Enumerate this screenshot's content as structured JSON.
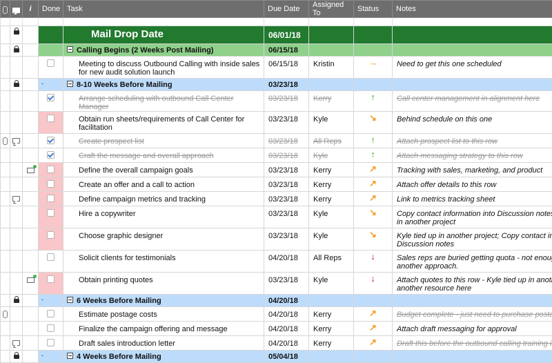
{
  "header": {
    "columns": [
      "",
      "",
      "i",
      "Done",
      "Task",
      "Due Date",
      "Assigned To",
      "Status",
      "Notes"
    ]
  },
  "rows": [
    {
      "kind": "sheet",
      "locked": true,
      "task": "Mail Drop Date",
      "due": "06/01/18"
    },
    {
      "kind": "section",
      "color": "green",
      "locked": true,
      "task": "Calling Begins (2 Weeks Post Mailing)",
      "due": "06/15/18"
    },
    {
      "kind": "task",
      "lines": 2,
      "done": false,
      "doneRed": false,
      "task": "Meeting to discuss Outbound Calling with inside sales for new audit solution launch",
      "due": "06/15/18",
      "assigned": "Kristin",
      "status": "right",
      "notes": "Need to get this one scheduled"
    },
    {
      "kind": "section",
      "color": "blue",
      "locked": true,
      "task": "8-10 Weeks Before Mailing",
      "due": "03/23/18"
    },
    {
      "kind": "task",
      "lines": 1,
      "done": true,
      "doneRed": false,
      "strike": true,
      "task": "Arrange scheduling with outbound Call Center Manager",
      "due": "03/23/18",
      "assigned": "Kerry",
      "status": "up",
      "notes": "Call center management in alignment here",
      "notesStrike": true
    },
    {
      "kind": "task",
      "lines": 2,
      "done": false,
      "doneRed": true,
      "task": "Obtain run sheets/requirements of Call Center for facilitation",
      "due": "03/23/18",
      "assigned": "Kyle",
      "status": "downright",
      "notes": "Behind schedule on this one"
    },
    {
      "kind": "task",
      "lines": 1,
      "done": true,
      "doneRed": false,
      "strike": true,
      "attach": true,
      "comment": true,
      "task": "Create prospect list",
      "due": "03/23/18",
      "assigned": "All Reps",
      "status": "up",
      "notes": "Attach prospect list to this row",
      "notesStrike": true
    },
    {
      "kind": "task",
      "lines": 1,
      "done": true,
      "doneRed": false,
      "strike": true,
      "task": "Craft the message and overall approach",
      "due": "03/23/18",
      "assigned": "Kyle",
      "status": "up",
      "notes": "Attach messaging strategy to this row",
      "notesStrike": true
    },
    {
      "kind": "task",
      "lines": 1,
      "done": false,
      "doneRed": true,
      "mail": true,
      "task": "Define the overall campaign goals",
      "due": "03/23/18",
      "assigned": "Kerry",
      "status": "upright",
      "notes": "Tracking with sales, marketing, and product"
    },
    {
      "kind": "task",
      "lines": 1,
      "done": false,
      "doneRed": true,
      "task": "Create an offer and a call to action",
      "due": "03/23/18",
      "assigned": "Kerry",
      "status": "upright",
      "notes": "Attach offer details to this row"
    },
    {
      "kind": "task",
      "lines": 1,
      "done": false,
      "doneRed": true,
      "comment": true,
      "task": "Define campaign metrics and tracking",
      "due": "03/23/18",
      "assigned": "Kerry",
      "status": "upright",
      "notes": "Link to metrics tracking sheet"
    },
    {
      "kind": "task",
      "lines": 2,
      "done": false,
      "doneRed": true,
      "task": "Hire a copywriter",
      "due": "03/23/18",
      "assigned": "Kyle",
      "status": "downright",
      "notes": "Copy contact information into Discussion notes; Kyle tied up in another project",
      "notesWrap": true
    },
    {
      "kind": "task",
      "lines": 2,
      "done": false,
      "doneRed": true,
      "task": "Choose graphic designer",
      "due": "03/23/18",
      "assigned": "Kyle",
      "status": "downright",
      "notes": "Kyle tied up in another project; Copy contact information into Discussion notes",
      "notesWrap": true
    },
    {
      "kind": "task",
      "lines": 2,
      "done": false,
      "doneRed": false,
      "task": "Solicit clients for testimonials",
      "due": "04/20/18",
      "assigned": "All Reps",
      "status": "down",
      "notes": "Sales reps are buried getting quota - not enough time, need another approach.",
      "notesWrap": true
    },
    {
      "kind": "task",
      "lines": 2,
      "done": false,
      "doneRed": true,
      "mail": true,
      "task": "Obtain printing quotes",
      "due": "03/23/18",
      "assigned": "Kyle",
      "status": "down",
      "notes": "Attach quotes to this row - Kyle tied up in another project, find another resource here",
      "notesWrap": true
    },
    {
      "kind": "section",
      "color": "blue",
      "locked": true,
      "task": "6 Weeks Before Mailing",
      "due": "04/20/18"
    },
    {
      "kind": "task",
      "lines": 1,
      "done": false,
      "doneRed": false,
      "attach": true,
      "task": "Estimate postage costs",
      "due": "04/20/18",
      "assigned": "Kerry",
      "status": "upright",
      "notes": "Budget complete - just need to purchase postage",
      "notesStrike": true
    },
    {
      "kind": "task",
      "lines": 1,
      "done": false,
      "doneRed": false,
      "task": "Finalize the campaign offering and message",
      "due": "04/20/18",
      "assigned": "Kerry",
      "status": "upright",
      "notes": "Attach draft messaging for approval"
    },
    {
      "kind": "task",
      "lines": 1,
      "done": false,
      "doneRed": false,
      "comment": true,
      "task": "Draft sales introduction letter",
      "due": "04/20/18",
      "assigned": "Kerry",
      "status": "upright",
      "notes": "Draft this before the outbound calling training in June",
      "notesStrike": true
    },
    {
      "kind": "section",
      "color": "blue",
      "locked": true,
      "task": "4 Weeks Before Mailing",
      "due": "05/04/18"
    }
  ],
  "icons": {
    "up": "↑",
    "down": "↓",
    "right": "→",
    "upright": "↗",
    "downright": "↘"
  },
  "colors": {
    "sheet": "#217a2e",
    "section_green": "#8fd18b",
    "section_blue": "#bddcfb",
    "done_red": "#f9c6c9"
  }
}
